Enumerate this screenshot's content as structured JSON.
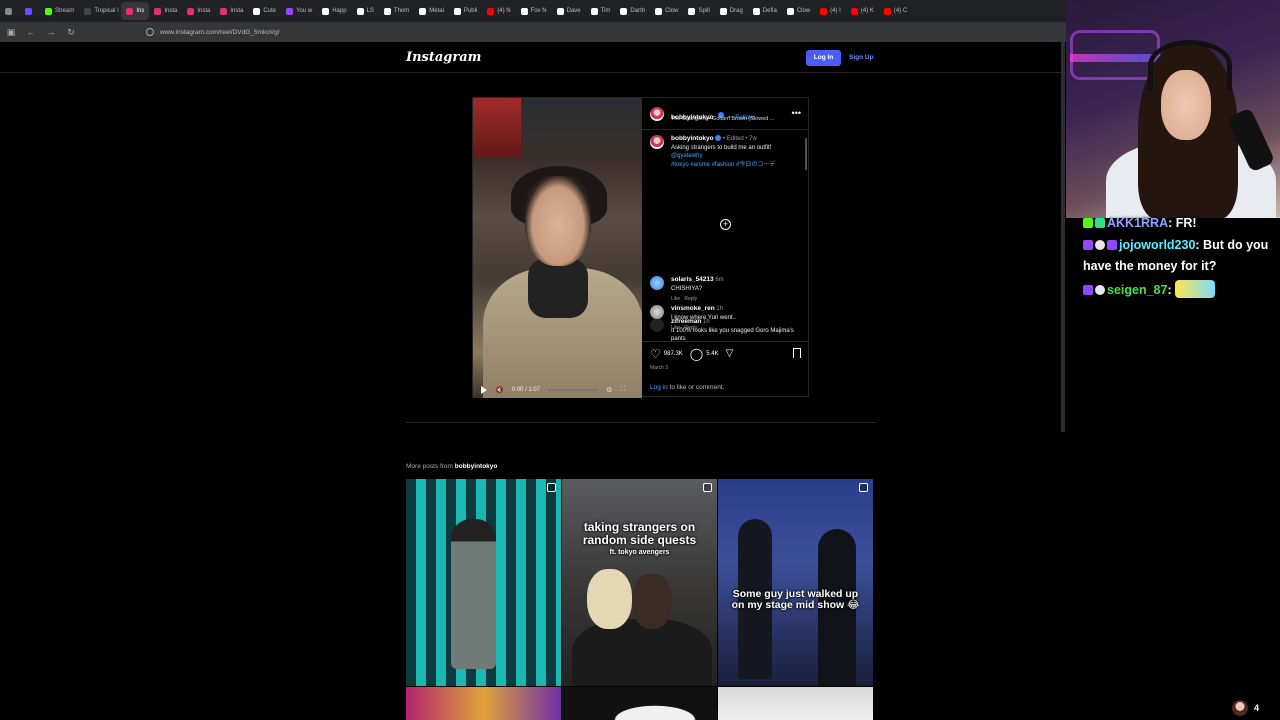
{
  "browser": {
    "tabs": [
      {
        "label": "",
        "color": "#888888"
      },
      {
        "label": "",
        "color": "#6e4bff"
      },
      {
        "label": "Stream",
        "color": "#53fc18"
      },
      {
        "label": "Tropical I",
        "color": "#444444"
      },
      {
        "label": "Ins",
        "color": "#e1306c",
        "active": true
      },
      {
        "label": "Insta",
        "color": "#e1306c"
      },
      {
        "label": "Insta",
        "color": "#e1306c"
      },
      {
        "label": "Insta",
        "color": "#e1306c"
      },
      {
        "label": "Cute",
        "color": "#ffffff"
      },
      {
        "label": "You w",
        "color": "#9146ff"
      },
      {
        "label": "Happ",
        "color": "#ffffff"
      },
      {
        "label": "LS",
        "color": "#ffffff"
      },
      {
        "label": "Thom",
        "color": "#ffffff"
      },
      {
        "label": "Metal",
        "color": "#ffffff"
      },
      {
        "label": "Publi",
        "color": "#ffffff"
      },
      {
        "label": "(4) N",
        "color": "#ff0000"
      },
      {
        "label": "Fox N",
        "color": "#ffffff"
      },
      {
        "label": "Dave",
        "color": "#ffffff"
      },
      {
        "label": "Tim",
        "color": "#ffffff"
      },
      {
        "label": "Darth",
        "color": "#ffffff"
      },
      {
        "label": "Clow",
        "color": "#ffffff"
      },
      {
        "label": "Spill",
        "color": "#ffffff"
      },
      {
        "label": "Drag",
        "color": "#ffffff"
      },
      {
        "label": "Defia",
        "color": "#ffffff"
      },
      {
        "label": "Clow",
        "color": "#ffffff"
      },
      {
        "label": "(4) I",
        "color": "#ff0000"
      },
      {
        "label": "(4) K",
        "color": "#ff0000"
      },
      {
        "label": "(4) C",
        "color": "#ff0000"
      }
    ],
    "url": "www.instagram.com/reel/DVdG_5mkoVg/"
  },
  "instagram": {
    "logo": "Instagram",
    "login_label": "Log In",
    "signup_label": "Sign Up",
    "post": {
      "username": "bobbyintokyo",
      "follow_label": "Follow",
      "dot": "•",
      "song": "The Stranglers • Golden Brown (Slowed ...",
      "caption_user": "bobbyintokyo",
      "caption_meta": "• Edited • 7w",
      "caption_text": "Asking strangers to build me an outfit!",
      "caption_mention": "@gyatewhy",
      "caption_tags": "#tokyo #anime #fashion #今日のコーデ",
      "video_time": "0:00 / 1:07",
      "comments": [
        {
          "user": "solaris_54213",
          "time": "6m",
          "text": "CHISHIYA?"
        },
        {
          "user": "zifreeman",
          "time": "1h",
          "text": "It 100% looks like you snagged Goro Majima's pants"
        },
        {
          "user": "vinsmoke_ren",
          "time": "1h",
          "text": "I know where Yuri went.."
        }
      ],
      "like_label": "Like",
      "reply_label": "Reply",
      "likes": "987.3K",
      "comment_count": "5.4K",
      "date": "March 3",
      "login_link": "Log in",
      "login_rest": " to like or comment."
    },
    "more_posts_prefix": "More posts from ",
    "more_posts_user": "bobbyintokyo",
    "grid_captions": [
      "",
      "taking strangers on random side quests",
      "Some guy just walked up on my stage mid show 😂"
    ],
    "grid_subcaption": "ft. tokyo avengers"
  },
  "stream": {
    "chat": [
      {
        "name": "AKK1RRA",
        "text": "FR!",
        "color": "#8fa3ff"
      },
      {
        "name": "jojoworld230",
        "text": "But do you have the money for it?",
        "color": "#5cf0ff"
      },
      {
        "name": "seigen_87",
        "text": "",
        "color": "#48e04a"
      }
    ],
    "viewer_count": "4"
  }
}
